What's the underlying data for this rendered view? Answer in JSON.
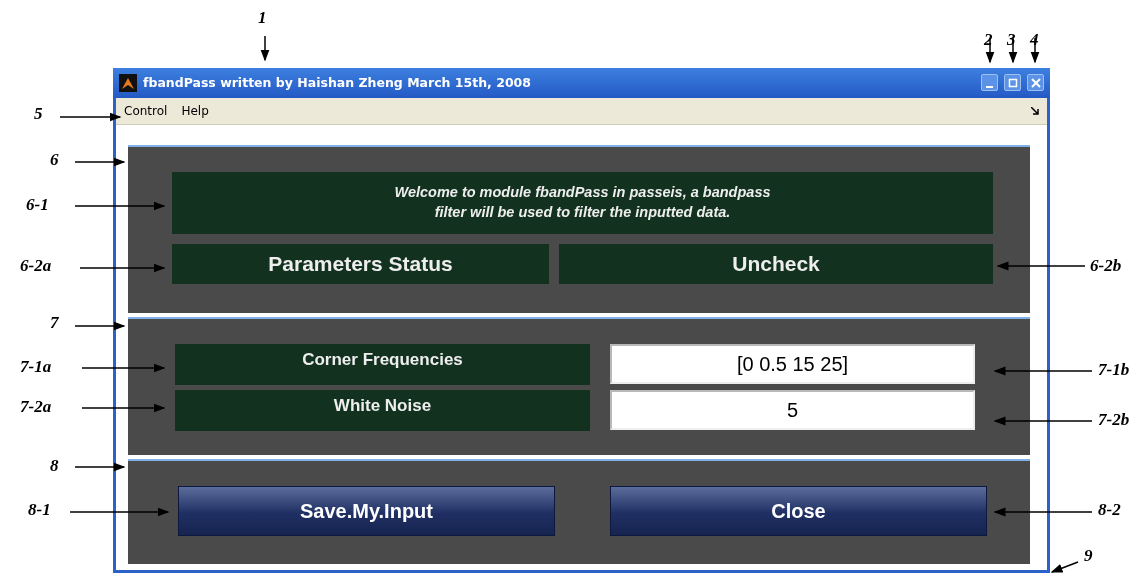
{
  "window": {
    "title": "fbandPass written by Haishan Zheng March 15th, 2008"
  },
  "menu": [
    "Control",
    "Help"
  ],
  "welcome": "Welcome to module fbandPass in passeis, a bandpass filter will be used to filter the inputted data.",
  "status": {
    "label": "Parameters Status",
    "value": "Uncheck"
  },
  "fields": [
    {
      "label": "Corner Frequencies",
      "value": "[0 0.5 15 25]"
    },
    {
      "label": "White Noise",
      "value": "5"
    }
  ],
  "buttons": [
    "Save.My.Input",
    "Close"
  ],
  "callouts": [
    "1",
    "2",
    "3",
    "4",
    "5",
    "6",
    "6-1",
    "6-2a",
    "6-2b",
    "7",
    "7-1a",
    "7-1b",
    "7-2a",
    "7-2b",
    "8",
    "8-1",
    "8-2",
    "9"
  ]
}
